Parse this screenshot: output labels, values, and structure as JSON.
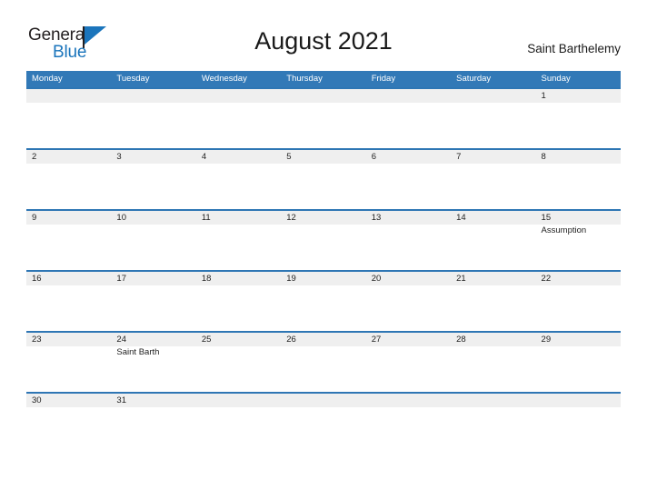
{
  "branding": {
    "logo_text_primary": "General",
    "logo_text_secondary": "Blue",
    "logo_icon": "flag-triangle-icon",
    "accent_color": "#1b75bc"
  },
  "header": {
    "title": "August 2021",
    "region": "Saint Barthelemy"
  },
  "colors": {
    "header_blue": "#3279b7",
    "row_divider_blue": "#2e76b4",
    "band_gray": "#efefef",
    "text_dark": "#222222"
  },
  "calendar": {
    "day_headers": [
      "Monday",
      "Tuesday",
      "Wednesday",
      "Thursday",
      "Friday",
      "Saturday",
      "Sunday"
    ],
    "weeks": [
      {
        "days": [
          {
            "num": "",
            "event": ""
          },
          {
            "num": "",
            "event": ""
          },
          {
            "num": "",
            "event": ""
          },
          {
            "num": "",
            "event": ""
          },
          {
            "num": "",
            "event": ""
          },
          {
            "num": "",
            "event": ""
          },
          {
            "num": "1",
            "event": ""
          }
        ]
      },
      {
        "days": [
          {
            "num": "2",
            "event": ""
          },
          {
            "num": "3",
            "event": ""
          },
          {
            "num": "4",
            "event": ""
          },
          {
            "num": "5",
            "event": ""
          },
          {
            "num": "6",
            "event": ""
          },
          {
            "num": "7",
            "event": ""
          },
          {
            "num": "8",
            "event": ""
          }
        ]
      },
      {
        "days": [
          {
            "num": "9",
            "event": ""
          },
          {
            "num": "10",
            "event": ""
          },
          {
            "num": "11",
            "event": ""
          },
          {
            "num": "12",
            "event": ""
          },
          {
            "num": "13",
            "event": ""
          },
          {
            "num": "14",
            "event": ""
          },
          {
            "num": "15",
            "event": "Assumption"
          }
        ]
      },
      {
        "days": [
          {
            "num": "16",
            "event": ""
          },
          {
            "num": "17",
            "event": ""
          },
          {
            "num": "18",
            "event": ""
          },
          {
            "num": "19",
            "event": ""
          },
          {
            "num": "20",
            "event": ""
          },
          {
            "num": "21",
            "event": ""
          },
          {
            "num": "22",
            "event": ""
          }
        ]
      },
      {
        "days": [
          {
            "num": "23",
            "event": ""
          },
          {
            "num": "24",
            "event": "Saint Barth"
          },
          {
            "num": "25",
            "event": ""
          },
          {
            "num": "26",
            "event": ""
          },
          {
            "num": "27",
            "event": ""
          },
          {
            "num": "28",
            "event": ""
          },
          {
            "num": "29",
            "event": ""
          }
        ]
      },
      {
        "days": [
          {
            "num": "30",
            "event": ""
          },
          {
            "num": "31",
            "event": ""
          },
          {
            "num": "",
            "event": ""
          },
          {
            "num": "",
            "event": ""
          },
          {
            "num": "",
            "event": ""
          },
          {
            "num": "",
            "event": ""
          },
          {
            "num": "",
            "event": ""
          }
        ]
      }
    ]
  }
}
